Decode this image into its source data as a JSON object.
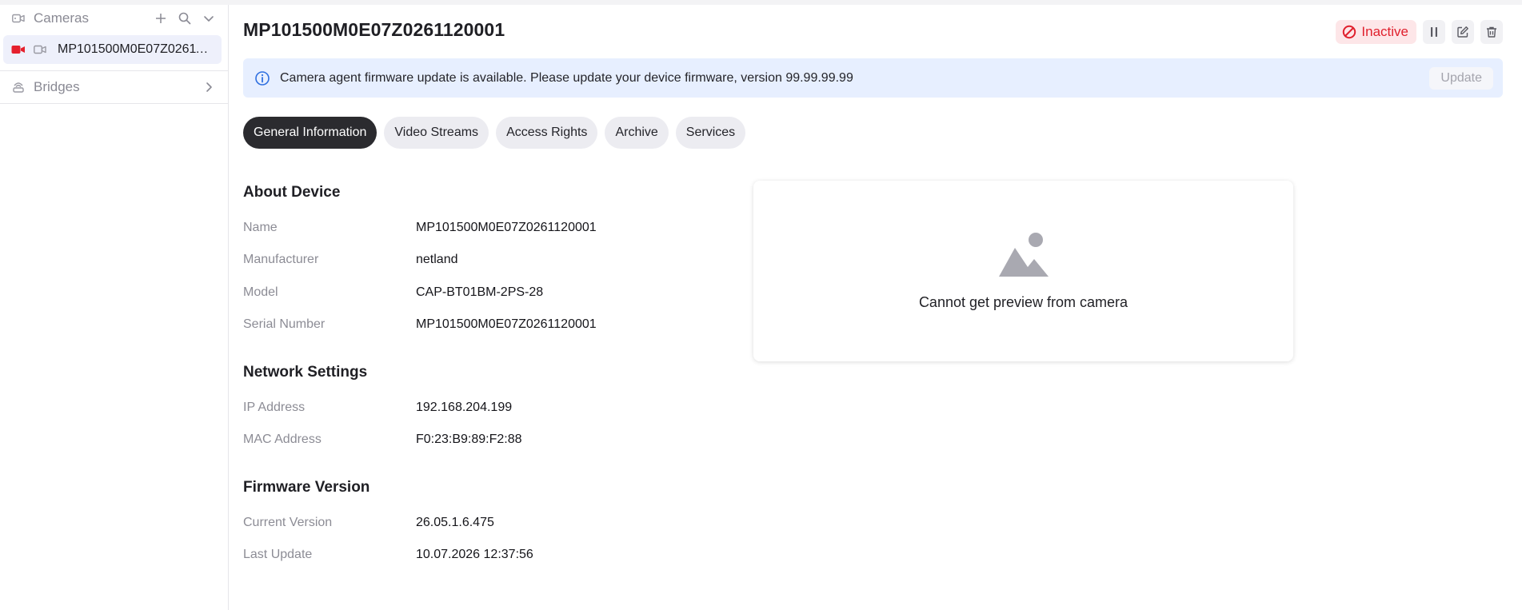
{
  "sidebar": {
    "cameras": {
      "label": "Cameras",
      "icon": "camera-icon"
    },
    "camera_item": {
      "label": "MP101500M0E07Z0261120001",
      "status_color": "#e5202d"
    },
    "bridges": {
      "label": "Bridges",
      "icon": "bridge-icon"
    }
  },
  "header": {
    "title": "MP101500M0E07Z0261120001",
    "status": "Inactive"
  },
  "notice": {
    "message": "Camera agent firmware update is available. Please update your device firmware, version 99.99.99.99",
    "button": "Update"
  },
  "tabs": [
    {
      "label": "General Information",
      "active": true
    },
    {
      "label": "Video Streams"
    },
    {
      "label": "Access Rights"
    },
    {
      "label": "Archive"
    },
    {
      "label": "Services"
    }
  ],
  "about": {
    "title": "About Device",
    "rows": [
      {
        "k": "Name",
        "v": "MP101500M0E07Z0261120001"
      },
      {
        "k": "Manufacturer",
        "v": "netland"
      },
      {
        "k": "Model",
        "v": "CAP-BT01BM-2PS-28"
      },
      {
        "k": "Serial Number",
        "v": "MP101500M0E07Z0261120001"
      }
    ]
  },
  "network": {
    "title": "Network Settings",
    "rows": [
      {
        "k": "IP Address",
        "v": "192.168.204.199"
      },
      {
        "k": "MAC Address",
        "v": "F0:23:B9:89:F2:88"
      }
    ]
  },
  "firmware": {
    "title": "Firmware Version",
    "rows": [
      {
        "k": "Current Version",
        "v": "26.05.1.6.475"
      },
      {
        "k": "Last Update",
        "v": "10.07.2026 12:37:56"
      }
    ]
  },
  "preview": {
    "message": "Cannot get preview from camera",
    "icon": "image-placeholder-icon"
  },
  "colors": {
    "accent_bg": "#e7efff",
    "inactive": "#e0202d",
    "tab_active": "#2b2b2f"
  }
}
